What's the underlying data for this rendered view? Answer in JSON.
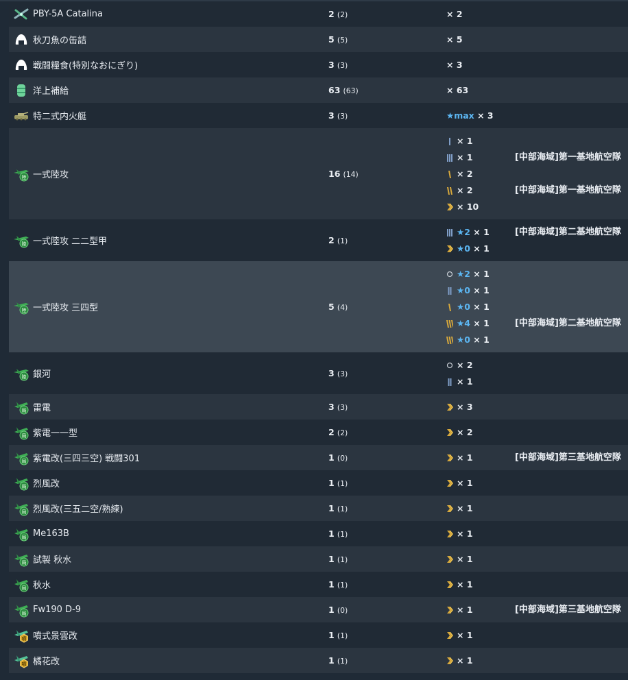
{
  "rows": [
    {
      "name": "PBY-5A Catalina",
      "icon": "flying-boat-icon",
      "count": "2",
      "count_sub": "(2)",
      "mods": [
        {
          "star": "",
          "mult": "× 2"
        }
      ],
      "fleets": [
        ""
      ],
      "height": 37
    },
    {
      "name": "秋刀魚の缶詰",
      "icon": "rice-ball-icon",
      "count": "5",
      "count_sub": "(5)",
      "mods": [
        {
          "star": "",
          "mult": "× 5"
        }
      ],
      "fleets": [
        ""
      ],
      "height": 37
    },
    {
      "name": "戦闘糧食(特別なおにぎり)",
      "icon": "rice-ball-icon",
      "count": "3",
      "count_sub": "(3)",
      "mods": [
        {
          "star": "",
          "mult": "× 3"
        }
      ],
      "fleets": [
        ""
      ],
      "height": 37
    },
    {
      "name": "洋上補給",
      "icon": "drum-icon",
      "count": "63",
      "count_sub": "(63)",
      "mods": [
        {
          "star": "",
          "mult": "× 63"
        }
      ],
      "fleets": [
        ""
      ],
      "height": 37
    },
    {
      "name": "特二式内火艇",
      "icon": "amphibious-tank-icon",
      "count": "3",
      "count_sub": "(3)",
      "mods": [
        {
          "level": "",
          "star": "★max",
          "mult": "× 3"
        }
      ],
      "fleets": [
        ""
      ],
      "height": 37
    },
    {
      "name": "一式陸攻",
      "icon": "land-attacker-icon",
      "count": "16",
      "count_sub": "(14)",
      "mods": [
        {
          "level": "prof-1",
          "star": "",
          "mult": "× 1"
        },
        {
          "level": "prof-3",
          "star": "",
          "mult": "× 1"
        },
        {
          "level": "prof-4",
          "star": "",
          "mult": "× 2"
        },
        {
          "level": "prof-5",
          "star": "",
          "mult": "× 2"
        },
        {
          "level": "prof-7",
          "star": "",
          "mult": "× 10"
        }
      ],
      "fleets": [
        "",
        "[中部海域]第一基地航空隊",
        "",
        "[中部海域]第一基地航空隊",
        ""
      ],
      "height": 133
    },
    {
      "name": "一式陸攻 二二型甲",
      "icon": "land-attacker-icon",
      "count": "2",
      "count_sub": "(1)",
      "mods": [
        {
          "level": "prof-3",
          "star": "★2",
          "mult": "× 1"
        },
        {
          "level": "prof-7",
          "star": "★0",
          "mult": "× 1"
        }
      ],
      "fleets": [
        "[中部海域]第二基地航空隊",
        ""
      ],
      "height": 61
    },
    {
      "name": "一式陸攻 三四型",
      "icon": "land-attacker-icon",
      "count": "5",
      "count_sub": "(4)",
      "mods": [
        {
          "level": "prof-0",
          "star": "★2",
          "mult": "× 1"
        },
        {
          "level": "prof-2",
          "star": "★0",
          "mult": "× 1"
        },
        {
          "level": "prof-4",
          "star": "★0",
          "mult": "× 1"
        },
        {
          "level": "prof-6",
          "star": "★4",
          "mult": "× 1"
        },
        {
          "level": "prof-6",
          "star": "★0",
          "mult": "× 1"
        }
      ],
      "fleets": [
        "",
        "",
        "",
        "[中部海域]第二基地航空隊",
        ""
      ],
      "height": 133,
      "highlight": true
    },
    {
      "name": "銀河",
      "icon": "land-attacker-icon",
      "count": "3",
      "count_sub": "(3)",
      "mods": [
        {
          "level": "prof-0",
          "star": "",
          "mult": "× 2"
        },
        {
          "level": "prof-2",
          "star": "",
          "mult": "× 1"
        }
      ],
      "fleets": [
        "",
        ""
      ],
      "height": 61
    },
    {
      "name": "雷電",
      "icon": "interceptor-icon",
      "count": "3",
      "count_sub": "(3)",
      "mods": [
        {
          "level": "prof-7",
          "star": "",
          "mult": "× 3"
        }
      ],
      "fleets": [
        ""
      ],
      "height": 37
    },
    {
      "name": "紫電一一型",
      "icon": "interceptor-icon",
      "count": "2",
      "count_sub": "(2)",
      "mods": [
        {
          "level": "prof-7",
          "star": "",
          "mult": "× 2"
        }
      ],
      "fleets": [
        ""
      ],
      "height": 37
    },
    {
      "name": "紫電改(三四三空) 戦闘301",
      "icon": "interceptor-icon",
      "count": "1",
      "count_sub": "(0)",
      "mods": [
        {
          "level": "prof-7",
          "star": "",
          "mult": "× 1"
        }
      ],
      "fleets": [
        "[中部海域]第三基地航空隊"
      ],
      "height": 37
    },
    {
      "name": "烈風改",
      "icon": "interceptor-icon",
      "count": "1",
      "count_sub": "(1)",
      "mods": [
        {
          "level": "prof-7",
          "star": "",
          "mult": "× 1"
        }
      ],
      "fleets": [
        ""
      ],
      "height": 37
    },
    {
      "name": "烈風改(三五二空/熟練)",
      "icon": "interceptor-icon",
      "count": "1",
      "count_sub": "(1)",
      "mods": [
        {
          "level": "prof-7",
          "star": "",
          "mult": "× 1"
        }
      ],
      "fleets": [
        ""
      ],
      "height": 37
    },
    {
      "name": "Me163B",
      "icon": "interceptor-icon",
      "count": "1",
      "count_sub": "(1)",
      "mods": [
        {
          "level": "prof-7",
          "star": "",
          "mult": "× 1"
        }
      ],
      "fleets": [
        ""
      ],
      "height": 37
    },
    {
      "name": "試製 秋水",
      "icon": "interceptor-icon",
      "count": "1",
      "count_sub": "(1)",
      "mods": [
        {
          "level": "prof-7",
          "star": "",
          "mult": "× 1"
        }
      ],
      "fleets": [
        ""
      ],
      "height": 37
    },
    {
      "name": "秋水",
      "icon": "interceptor-icon",
      "count": "1",
      "count_sub": "(1)",
      "mods": [
        {
          "level": "prof-7",
          "star": "",
          "mult": "× 1"
        }
      ],
      "fleets": [
        ""
      ],
      "height": 37
    },
    {
      "name": "Fw190 D-9",
      "icon": "interceptor-icon",
      "count": "1",
      "count_sub": "(0)",
      "mods": [
        {
          "level": "prof-7",
          "star": "",
          "mult": "× 1"
        }
      ],
      "fleets": [
        "[中部海域]第三基地航空隊"
      ],
      "height": 37
    },
    {
      "name": "噴式景雲改",
      "icon": "jet-bomber-icon",
      "count": "1",
      "count_sub": "(1)",
      "mods": [
        {
          "level": "prof-7",
          "star": "",
          "mult": "× 1"
        }
      ],
      "fleets": [
        ""
      ],
      "height": 37
    },
    {
      "name": "橘花改",
      "icon": "jet-bomber-icon",
      "count": "1",
      "count_sub": "(1)",
      "mods": [
        {
          "level": "prof-7",
          "star": "",
          "mult": "× 1"
        }
      ],
      "fleets": [
        ""
      ],
      "height": 37
    }
  ],
  "colors": {
    "row_odd": "#202a35",
    "row_even": "#2b3540",
    "row_highlight": "#3d4853",
    "star": "#5cb6f2",
    "prof_blue": "#7f9dc6",
    "prof_gold": "#d8a93c"
  }
}
